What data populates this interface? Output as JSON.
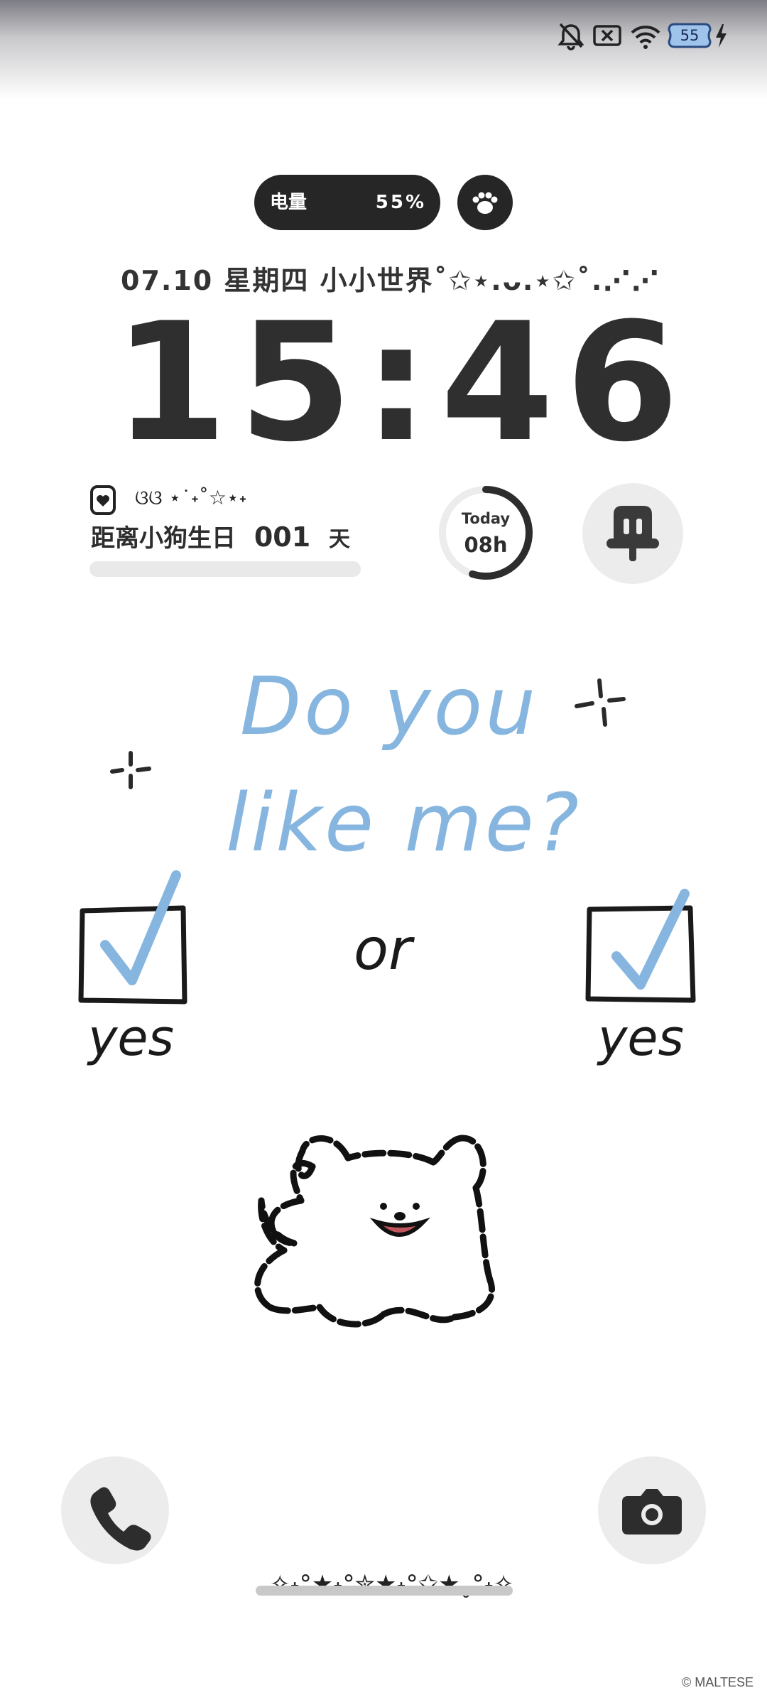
{
  "status_bar": {
    "icons": [
      "bell-muted-icon",
      "sim-off-icon",
      "wifi-icon",
      "battery-icon",
      "charging-bolt-icon"
    ],
    "battery_level": "55"
  },
  "widgets": {
    "battery_pill": {
      "label": "电量",
      "value": "55%"
    },
    "paw_button_icon": "paw-icon",
    "date_line": "07.10  星期四   小小世界˚✩⋆.ᴗ.⋆✩˚.⋰⋰",
    "time": "15:46",
    "birthday": {
      "deco": "ଓଓ ⋆˙˖˚☆⋆˖",
      "label": "距离小狗生日",
      "days": "001",
      "unit": "天"
    },
    "today_ring": {
      "title": "Today",
      "value": "08h",
      "progress_fraction": 0.55
    },
    "charging_icon": "charging-plug-icon"
  },
  "wallpaper": {
    "line1": "Do you",
    "line2": "like me?",
    "or": "or",
    "yes_left": "yes",
    "yes_right": "yes",
    "accent_color": "#86b6df",
    "ink_color": "#1a1a1a"
  },
  "shortcuts": {
    "left_icon": "phone-icon",
    "right_icon": "camera-icon"
  },
  "bottom": {
    "stars": "✧˖°★˖°✮★˖°✩★˳°˖✧",
    "credit": "© MALTESE"
  }
}
